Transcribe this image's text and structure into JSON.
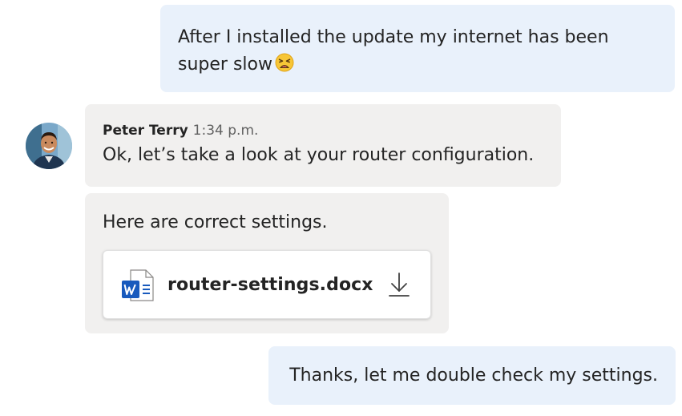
{
  "messages": {
    "first": {
      "text": "After I installed the update my internet has been super slow",
      "emoji_icon": "weary-face-icon"
    },
    "second": {
      "sender": "Peter Terry",
      "time": "1:34 p.m.",
      "text": "Ok, let’s take a look at your router configuration."
    },
    "third": {
      "text": "Here are correct settings.",
      "attachment": {
        "file_name": "router-settings.docx",
        "file_icon": "word-document-icon",
        "action_icon": "download-icon"
      }
    },
    "fourth": {
      "text": "Thanks, let me double check my settings."
    }
  },
  "colors": {
    "outgoing_bubble": "#e9f1fb",
    "incoming_bubble": "#f1f0ef",
    "word_blue": "#185abd"
  }
}
